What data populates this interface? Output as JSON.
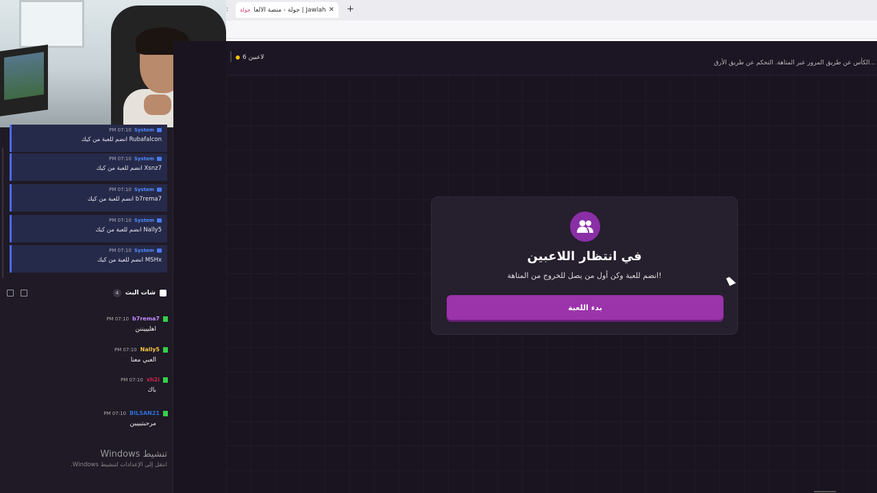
{
  "browser": {
    "tab_title": "Jawlah | جولة - منصة الألعاب الت",
    "tab_favicon": "جولة",
    "close_glyph": "✕",
    "new_tab_glyph": "+"
  },
  "header": {
    "player_count": "6 لاعبين",
    "description": "...الكأس عن طريق المرور عبر المتاهة. التحكم عن طريق الأرق"
  },
  "sidebar": {
    "system_messages": [
      {
        "name": "System",
        "time": "PM 07:10",
        "text": "Rubafalcon انضم للعبة من كيك"
      },
      {
        "name": "System",
        "time": "PM 07:10",
        "text": "Xsnz7 انضم للعبة من كيك"
      },
      {
        "name": "System",
        "time": "PM 07:10",
        "text": "b7rema7 انضم للعبة من كيك"
      },
      {
        "name": "System",
        "time": "PM 07:10",
        "text": "Nally5 انضم للعبة من كيك"
      },
      {
        "name": "System",
        "time": "PM 07:10",
        "text": "MSHx انضم للعبة من كيك"
      }
    ],
    "chat": {
      "title": "شات البث",
      "count": "4",
      "messages": [
        {
          "user": "b7rema7",
          "color": "#c58cff",
          "time": "PM 07:10",
          "text": "اهليييننن"
        },
        {
          "user": "Nally5",
          "color": "#f5c842",
          "time": "PM 07:10",
          "text": "العبي معنا"
        },
        {
          "user": "xh2i",
          "color": "#d0244c",
          "time": "PM 07:10",
          "text": "باك"
        },
        {
          "user": "BILSAN21",
          "color": "#2f6fd6",
          "time": "PM 07:10",
          "text": "مرحبتيييين"
        }
      ]
    }
  },
  "card": {
    "title": "في انتظار اللاعبين",
    "subtitle": "انضم للعبة وكن أول من يصل للخروج من المتاهة!",
    "button": "بدء اللعبة",
    "icon": "users-icon",
    "accent": "#9b33ab"
  },
  "windows": {
    "title": "تنشيط Windows",
    "subtitle": "انتقل إلى الإعدادات لتنشيط Windows."
  }
}
